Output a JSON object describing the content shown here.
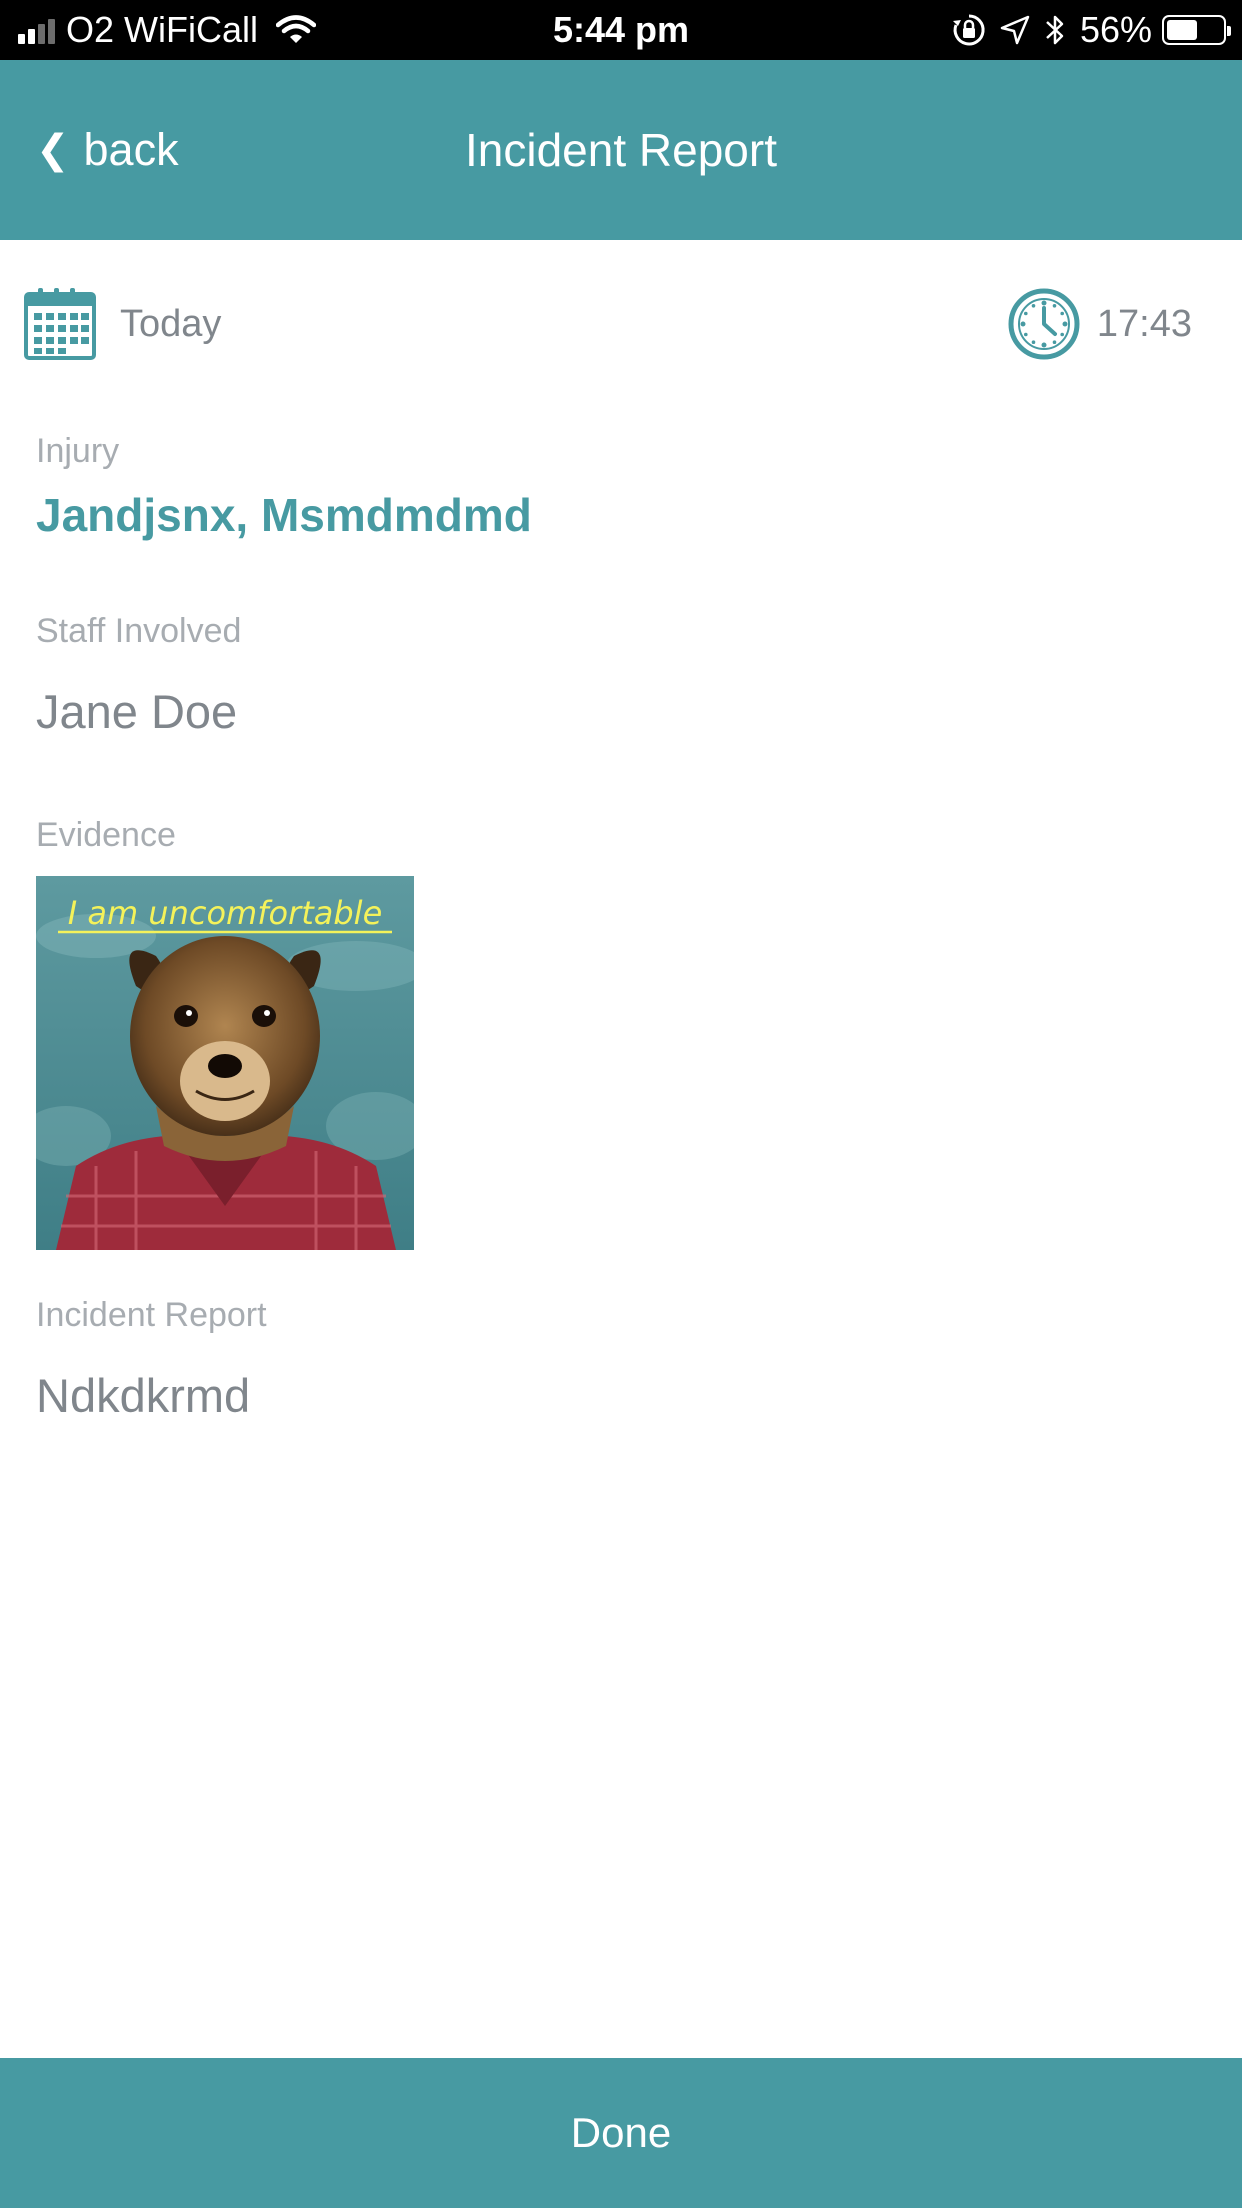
{
  "status_bar": {
    "carrier": "O2 WiFiCall",
    "time": "5:44 pm",
    "battery_percent": "56%",
    "battery_level": 0.56,
    "signal_bars_filled": 2,
    "signal_bars_total": 4
  },
  "nav": {
    "back_chevron": "❮",
    "back_label": "back",
    "title": "Incident Report"
  },
  "date_row": {
    "date": "Today",
    "time": "17:43"
  },
  "fields": {
    "injury_label": "Injury",
    "injury_value": "Jandjsnx, Msmdmdmd",
    "staff_label": "Staff Involved",
    "staff_value": "Jane Doe",
    "evidence_label": "Evidence",
    "evidence_caption": "I am uncomfortable",
    "report_label": "Incident Report",
    "report_value": "Ndkdkrmd"
  },
  "footer": {
    "done_label": "Done"
  },
  "colors": {
    "accent": "#479aa2",
    "label_gray": "#a7acb1",
    "value_gray": "#80868c",
    "status_bar_bg": "#000000"
  },
  "icons": [
    "signal-icon",
    "wifi-icon",
    "orientation-lock-icon",
    "location-arrow-icon",
    "bluetooth-icon",
    "battery-icon",
    "chevron-left-icon",
    "calendar-icon",
    "clock-icon"
  ]
}
